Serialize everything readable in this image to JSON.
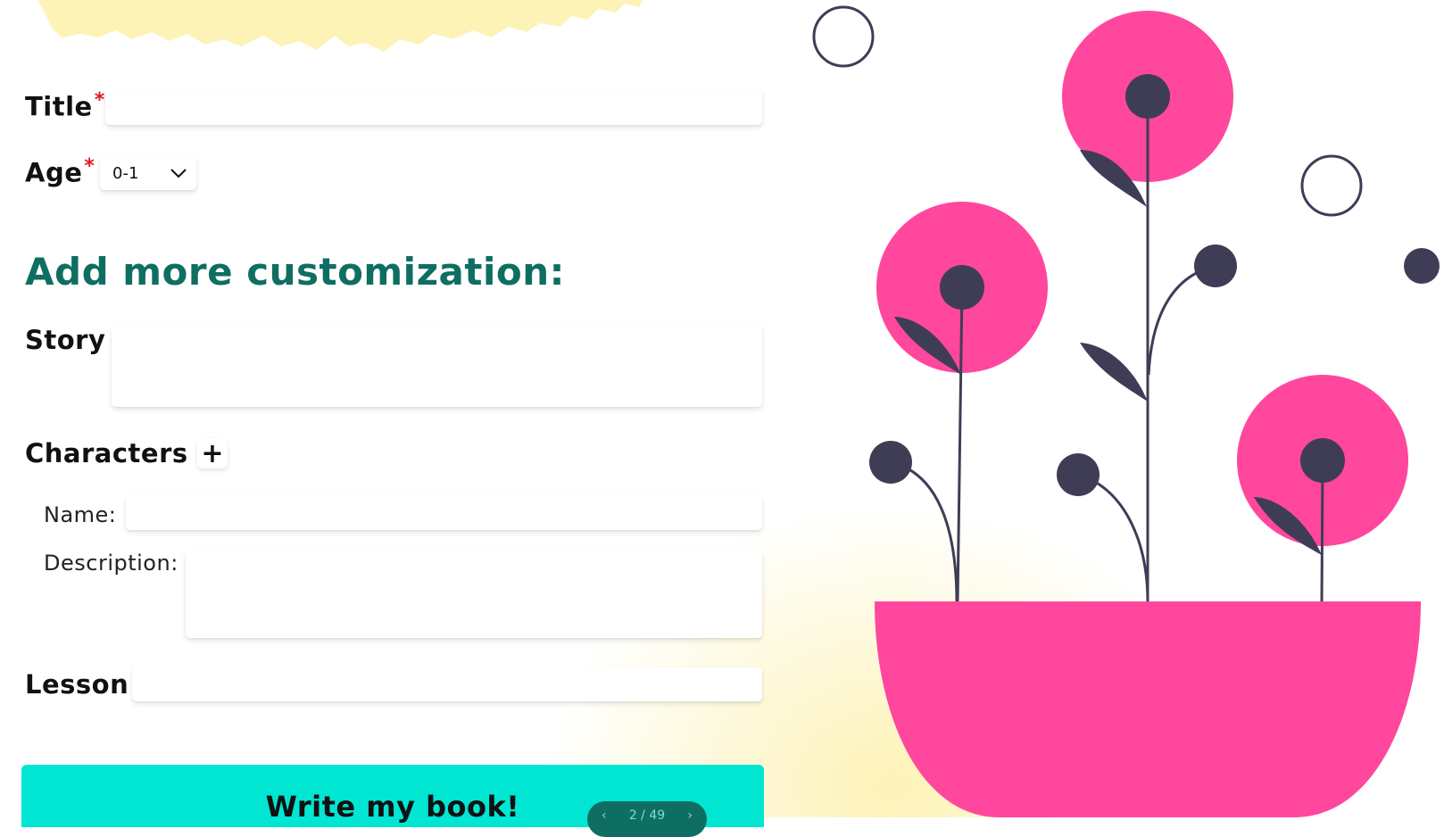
{
  "form": {
    "title_label": "Title",
    "required_mark": "*",
    "title_value": "",
    "age_label": "Age",
    "age_value": "0-1",
    "section_heading": "Add more customization:",
    "story_label": "Story",
    "story_value": "",
    "characters_label": "Characters",
    "add_character": "+",
    "name_label": "Name:",
    "name_value": "",
    "description_label": "Description:",
    "description_value": "",
    "lesson_label": "Lesson",
    "lesson_value": "",
    "submit_label": "Write my book!"
  },
  "pager": {
    "prev": "‹",
    "text": "2 / 49",
    "next": "›"
  },
  "icons": {
    "age_dropdown": "chevron-down-icon",
    "add_character": "plus-icon"
  },
  "colors": {
    "accent": "#00e6d2",
    "heading": "#0f6e62",
    "required": "#e01b1b",
    "flower_pink": "#ff479e",
    "flower_dark": "#3f3d56",
    "paper_yellow": "#fdf3b6"
  }
}
